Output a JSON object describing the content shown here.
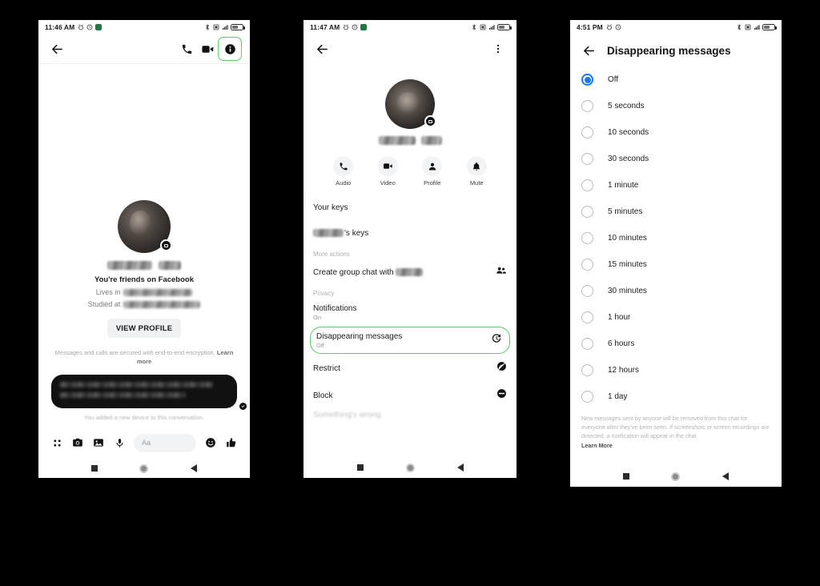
{
  "screens": [
    {
      "id": "chat-thread",
      "status_bar": {
        "time": "11:46 AM",
        "icons": [
          "alarm-icon",
          "clock-icon",
          "app-icon",
          "bluetooth-icon",
          "sim-icon",
          "signal-icon",
          "battery-icon"
        ]
      },
      "appbar": {
        "back": "back-arrow",
        "call": "phone-icon",
        "video": "video-icon",
        "info": "info-icon"
      },
      "profile": {
        "friends_status": "You're friends on Facebook",
        "lives_in_label": "Lives in",
        "studied_at_label": "Studied at",
        "view_profile_button": "VIEW PROFILE"
      },
      "encryption_note": "Messages and calls are secured with end-to-end encryption.",
      "encryption_link": "Learn more",
      "system_message": "You added a new device to this conversation.",
      "composer": {
        "placeholder": "Aa",
        "icons": [
          "apps-icon",
          "camera-icon",
          "gallery-icon",
          "microphone-icon",
          "emoji-icon",
          "thumbs-up-icon"
        ]
      },
      "nav": [
        "recents-button",
        "home-button",
        "back-button"
      ]
    },
    {
      "id": "conversation-details",
      "status_bar": {
        "time": "11:47 AM"
      },
      "appbar": {
        "back": "back-arrow",
        "overflow": "more-vertical-icon"
      },
      "quick_actions": [
        {
          "label": "Audio",
          "icon": "phone-icon"
        },
        {
          "label": "Video",
          "icon": "video-icon"
        },
        {
          "label": "Profile",
          "icon": "person-icon"
        },
        {
          "label": "Mute",
          "icon": "bell-icon"
        }
      ],
      "items": [
        {
          "title": "Your keys",
          "sub": "",
          "icon": "",
          "type": "row"
        },
        {
          "title": "'s keys",
          "sub": "",
          "icon": "",
          "type": "row-redacted"
        },
        {
          "title": "More actions",
          "type": "section"
        },
        {
          "title": "Create group chat with",
          "sub": "",
          "icon": "group-icon",
          "type": "row-redacted-inline"
        },
        {
          "title": "Privacy",
          "type": "section"
        },
        {
          "title": "Notifications",
          "sub": "On",
          "icon": "",
          "type": "row"
        },
        {
          "title": "Disappearing messages",
          "sub": "Off",
          "icon": "history-icon",
          "type": "row",
          "highlighted": true
        },
        {
          "title": "Restrict",
          "sub": "",
          "icon": "restrict-icon",
          "type": "row"
        },
        {
          "title": "Block",
          "sub": "",
          "icon": "block-icon",
          "type": "row"
        },
        {
          "title": "Something's wrong",
          "sub": "",
          "icon": "",
          "type": "row-cut"
        }
      ]
    },
    {
      "id": "disappearing-messages",
      "status_bar": {
        "time": "4:51 PM"
      },
      "title": "Disappearing messages",
      "options": [
        {
          "label": "Off",
          "selected": true
        },
        {
          "label": "5 seconds",
          "selected": false
        },
        {
          "label": "10 seconds",
          "selected": false
        },
        {
          "label": "30 seconds",
          "selected": false
        },
        {
          "label": "1 minute",
          "selected": false
        },
        {
          "label": "5 minutes",
          "selected": false
        },
        {
          "label": "10 minutes",
          "selected": false
        },
        {
          "label": "15 minutes",
          "selected": false
        },
        {
          "label": "30 minutes",
          "selected": false
        },
        {
          "label": "1 hour",
          "selected": false
        },
        {
          "label": "6 hours",
          "selected": false
        },
        {
          "label": "12 hours",
          "selected": false
        },
        {
          "label": "1 day",
          "selected": false
        }
      ],
      "footnote": "New messages sent by anyone will be removed from this chat for everyone after they've been seen. If screenshots or screen recordings are detected, a notification will appear in the chat",
      "footnote_link": "Learn More"
    }
  ],
  "colors": {
    "highlight_green": "#5dc96a",
    "radio_blue": "#1878f2",
    "background": "#000000",
    "surface": "#ffffff"
  }
}
